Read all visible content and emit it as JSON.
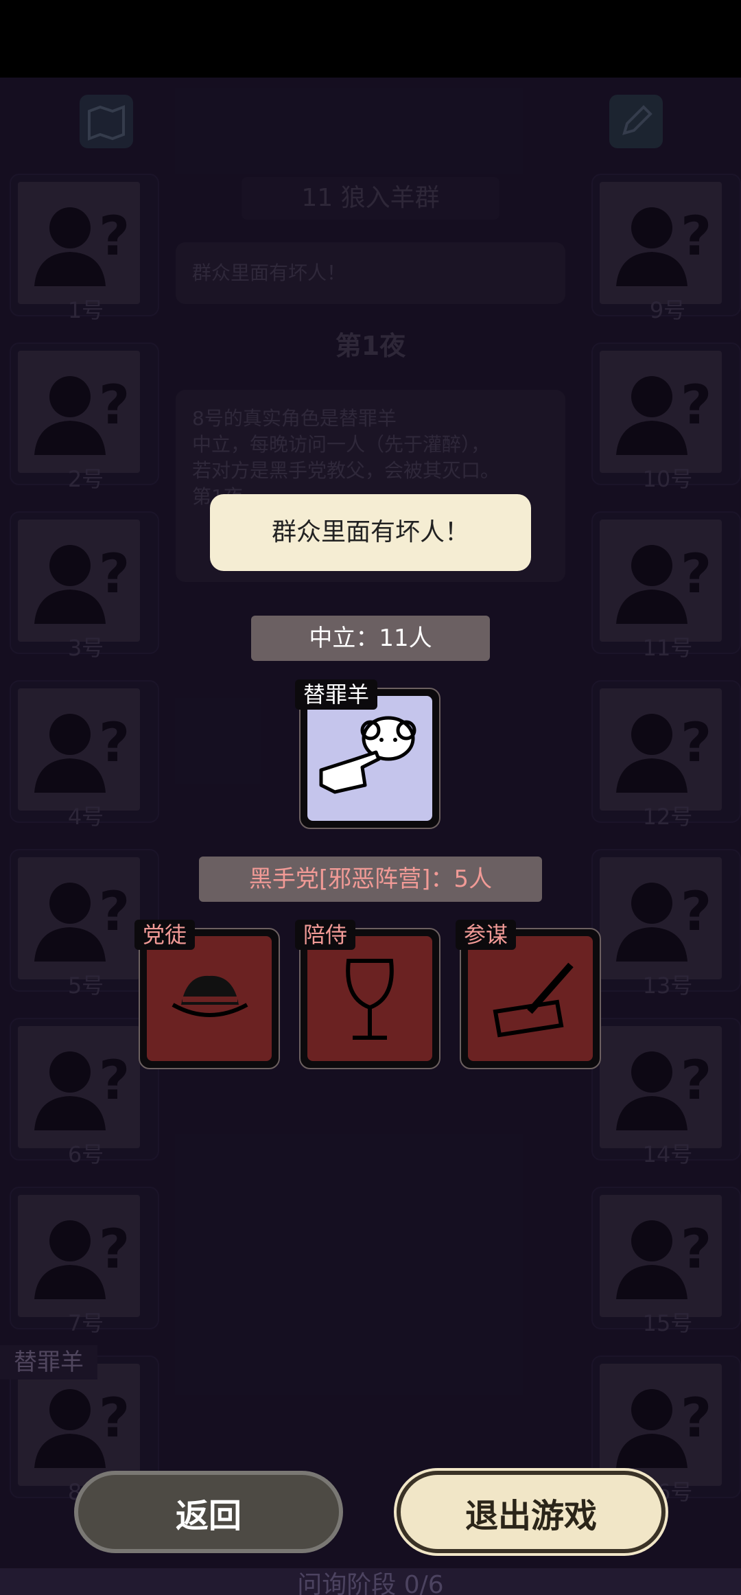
{
  "title": "11  狼入羊群",
  "log": {
    "announcement": "群众里面有坏人！",
    "night_label": "第1夜",
    "lines": [
      "8号的真实角色是替罪羊",
      "中立，每晚访问一人（先于灌醉），",
      "若对方是黑手党教父，会被其灭口。",
      "第1夜..."
    ]
  },
  "players_left": [
    "1号",
    "2号",
    "3号",
    "4号",
    "5号",
    "6号",
    "7号",
    "8号"
  ],
  "players_right": [
    "9号",
    "10号",
    "11号",
    "12号",
    "13号",
    "14号",
    "15号",
    "16号"
  ],
  "revealed_tag": "替罪羊",
  "popup": {
    "toast": "群众里面有坏人！",
    "neutral_header": "中立：11人",
    "neutral_role": "替罪羊",
    "evil_header": "黑手党[邪恶阵营]：5人",
    "evil_roles": [
      "党徒",
      "陪侍",
      "参谋"
    ]
  },
  "buttons": {
    "back": "返回",
    "exit": "退出游戏"
  },
  "phase": "问询阶段 0/6",
  "colors": {
    "neutral_card": "#c5c5ec",
    "evil_card": "#6b2222",
    "evil_text": "#f19a96"
  },
  "icons": {
    "map": "map-icon",
    "edit": "pencil-icon"
  }
}
